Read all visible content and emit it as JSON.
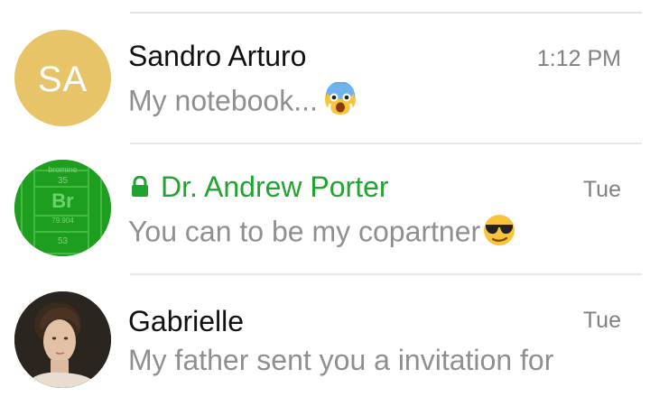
{
  "chats": [
    {
      "initials": "SA",
      "name": "Sandro Arturo",
      "time": "1:12 PM",
      "preview": "My notebook...",
      "emoji_icon": "scared-face-emoji",
      "avatar_color": "#e8c468"
    },
    {
      "name": "Dr. Andrew Porter",
      "time": "Tue",
      "preview": "You can to be my copartner",
      "emoji_icon": "sunglasses-face-emoji",
      "name_color": "#1fa52f",
      "secret": true,
      "avatar": {
        "type": "periodic-table-element",
        "label": "bromine",
        "number": "35",
        "symbol": "Br",
        "mass": "79.904",
        "next_number": "53",
        "color": "#1e9e1e"
      }
    },
    {
      "name": "Gabrielle",
      "time": "Tue",
      "preview": "My father sent you a invitation for",
      "avatar": {
        "type": "portrait-photo"
      }
    }
  ]
}
